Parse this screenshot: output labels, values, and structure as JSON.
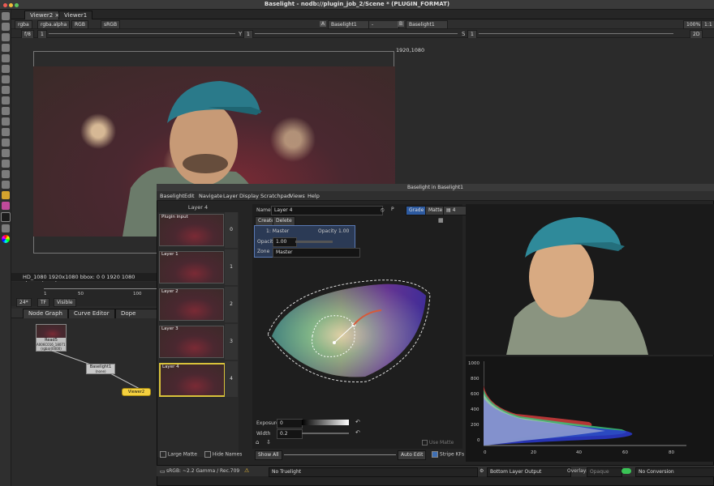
{
  "window": {
    "title": "Baselight - nodb://plugin_job_2/Scene * (PLUGIN_FORMAT)"
  },
  "tabs": [
    {
      "label": "Viewer2"
    },
    {
      "label": "Viewer1"
    }
  ],
  "viewer_controls": {
    "channels": "rgba",
    "alpha": "rgba.alpha",
    "rgb": "RGB",
    "colorspace": "sRGB",
    "input_a": "Baselight1",
    "input_b": "Baselight1",
    "fstop": "f/8",
    "fstop_value": "1",
    "y_label": "Y",
    "y_value": "1",
    "s_label": "S",
    "s_value": "1",
    "zoom": "100%",
    "ratio": "1:1",
    "mode": "2D",
    "a_tag": "A",
    "b_tag": "B"
  },
  "viewer": {
    "corner_label": "1920,1080",
    "format_info": "HD_1080 1920x1080  bbox: 0 0 1920 1080 channels: rgba"
  },
  "timeline": {
    "fps": "24*",
    "tf": "TF",
    "visible": "Visible",
    "ticks": [
      "1",
      "50",
      "100"
    ]
  },
  "node_graph": {
    "tabs": [
      "Node Graph",
      "Curve Editor",
      "Dope Sheet"
    ],
    "read_node": {
      "title": "Read5",
      "sub": "A006C016_180711_1.0R...0bf.mov",
      "extra": "(rgba)(0000)"
    },
    "bl_node": {
      "title": "Baselight1",
      "sub": "(none)"
    },
    "viewer_node": {
      "title": "Viewer2"
    }
  },
  "baselight": {
    "title": "Baselight in Baselight1",
    "menu": [
      "Baselight",
      "Edit",
      "Navigate",
      "Layer",
      "Display",
      "Scratchpad",
      "Views",
      "Help"
    ],
    "layer_header": "Layer 4",
    "layers": [
      {
        "name": "Plugin input",
        "num": "0"
      },
      {
        "name": "Layer 1",
        "num": "1"
      },
      {
        "name": "Layer 2",
        "num": "2"
      },
      {
        "name": "Layer 3",
        "num": "3"
      },
      {
        "name": "Layer 4",
        "num": "4"
      }
    ],
    "name_label": "Name:",
    "name_value": "Layer 4",
    "p_label": "P",
    "tab_grade": "Grade",
    "tab_matte": "Matte",
    "count_value": "4",
    "create": "Create",
    "delete": "Delete",
    "master_title": "1: Master",
    "opacity_label": "Opacity 1.00",
    "opacity_field_label": "Opacity",
    "opacity_value": "1.00",
    "zone_label": "Zone",
    "zone_value": "Master",
    "exposure_label": "Exposure",
    "exposure_value": "0",
    "width_label": "Width",
    "width_value": "0.2",
    "use_matte": "Use Matte",
    "show_all": "Show All",
    "auto_edit": "Auto Edit",
    "stripe_kfs": "Stripe KFs",
    "large_matte": "Large Matte",
    "hide_names": "Hide Names",
    "bottom": {
      "gamma": "sRGB: ~2.2 Gamma / Rec.709",
      "truelight": "No Truelight",
      "layer_output": "Bottom Layer Output",
      "overlay_label": "Overlay:",
      "overlay_value": "Opaque",
      "conversion": "No Conversion"
    },
    "hist_y_ticks": [
      "1000",
      "800",
      "600",
      "400",
      "200",
      "0"
    ],
    "hist_x_ticks": [
      "0",
      "20",
      "40",
      "60",
      "80"
    ],
    "colors": {
      "accent": "#3f6fb3",
      "viewer_node": "#f4d03f",
      "master_box": "#2b3a55"
    }
  }
}
